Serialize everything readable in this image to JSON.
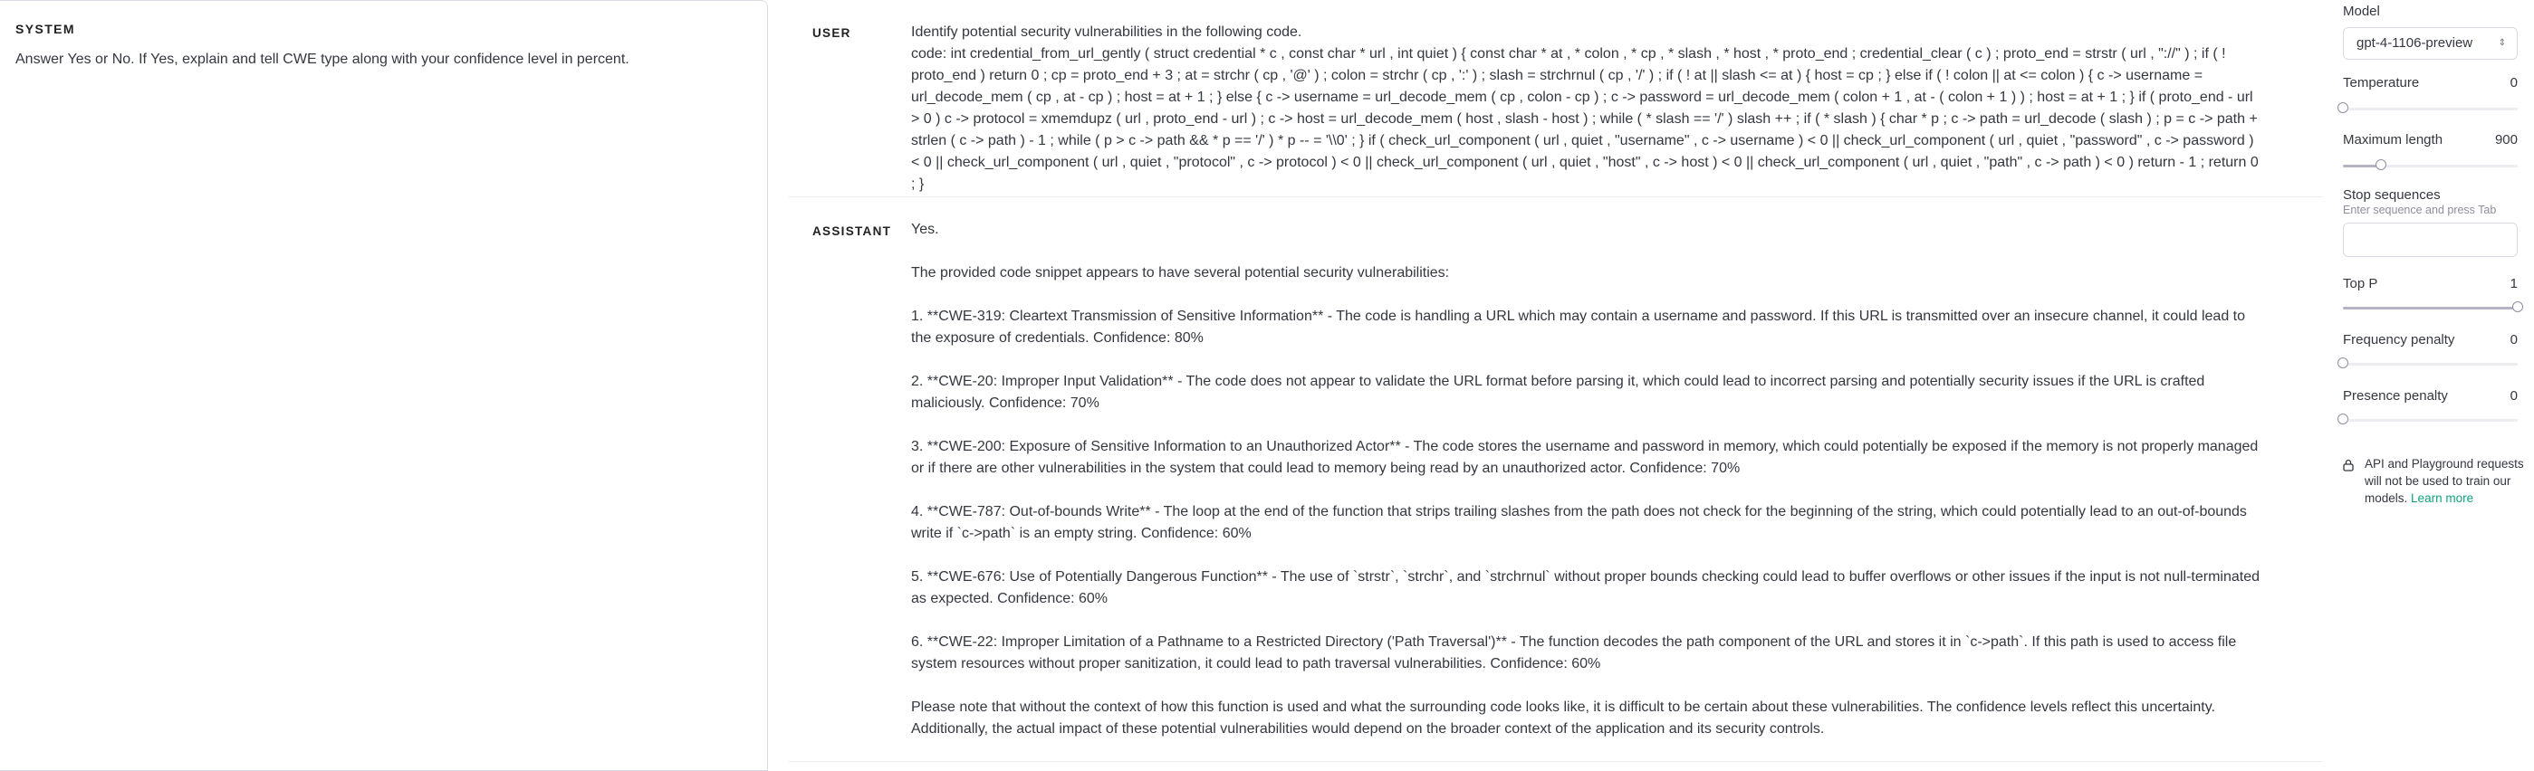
{
  "system": {
    "label": "SYSTEM",
    "text": "Answer Yes or No. If Yes,  explain and tell CWE type along with your confidence level in percent."
  },
  "user": {
    "label": "USER",
    "intro": "Identify potential security vulnerabilities in the following code.",
    "code": "code: int credential_from_url_gently ( struct credential * c , const char * url , int quiet ) { const char * at , * colon , * cp , * slash , * host , * proto_end ; credential_clear ( c ) ; proto_end = strstr ( url , \"://\" ) ; if ( ! proto_end ) return 0 ; cp = proto_end + 3 ; at = strchr ( cp , '@' ) ; colon = strchr ( cp , ':' ) ; slash = strchrnul ( cp , '/' ) ; if ( ! at || slash <= at ) { host = cp ; } else if ( ! colon || at <= colon ) { c -> username = url_decode_mem ( cp , at - cp ) ; host = at + 1 ; } else { c -> username = url_decode_mem ( cp , colon - cp ) ; c -> password = url_decode_mem ( colon + 1 , at - ( colon + 1 ) ) ; host = at + 1 ; } if ( proto_end - url > 0 ) c -> protocol = xmemdupz ( url , proto_end - url ) ; c -> host = url_decode_mem ( host , slash - host ) ; while ( * slash == '/' ) slash ++ ; if ( * slash ) { char * p ; c -> path = url_decode ( slash ) ; p = c -> path + strlen ( c -> path ) - 1 ; while ( p > c -> path && * p == '/' ) * p -- = '\\\\0' ; } if ( check_url_component ( url , quiet , \"username\" , c -> username ) < 0 || check_url_component ( url , quiet , \"password\" , c -> password ) < 0 || check_url_component ( url , quiet , \"protocol\" , c -> protocol ) < 0 || check_url_component ( url , quiet , \"host\" , c -> host ) < 0 || check_url_component ( url , quiet , \"path\" , c -> path ) < 0 ) return - 1 ; return 0 ; }"
  },
  "assistant": {
    "label": "ASSISTANT",
    "paragraphs": [
      "Yes.",
      "The provided code snippet appears to have several potential security vulnerabilities:",
      "1. **CWE-319: Cleartext Transmission of Sensitive Information** - The code is handling a URL which may contain a username and password. If this URL is transmitted over an insecure channel, it could lead to the exposure of credentials. Confidence: 80%",
      "2. **CWE-20: Improper Input Validation** - The code does not appear to validate the URL format before parsing it, which could lead to incorrect parsing and potentially security issues if the URL is crafted maliciously. Confidence: 70%",
      "3. **CWE-200: Exposure of Sensitive Information to an Unauthorized Actor** - The code stores the username and password in memory, which could potentially be exposed if the memory is not properly managed or if there are other vulnerabilities in the system that could lead to memory being read by an unauthorized actor. Confidence: 70%",
      "4. **CWE-787: Out-of-bounds Write** - The loop at the end of the function that strips trailing slashes from the path does not check for the beginning of the string, which could potentially lead to an out-of-bounds write if `c->path` is an empty string. Confidence: 60%",
      "5. **CWE-676: Use of Potentially Dangerous Function** - The use of `strstr`, `strchr`, and `strchrnul` without proper bounds checking could lead to buffer overflows or other issues if the input is not null-terminated as expected. Confidence: 60%",
      "6. **CWE-22: Improper Limitation of a Pathname to a Restricted Directory ('Path Traversal')** - The function decodes the path component of the URL and stores it in `c->path`. If this path is used to access file system resources without proper sanitization, it could lead to path traversal vulnerabilities. Confidence: 60%",
      "Please note that without the context of how this function is used and what the surrounding code looks like, it is difficult to be certain about these vulnerabilities. The confidence levels reflect this uncertainty. Additionally, the actual impact of these potential vulnerabilities would depend on the broader context of the application and its security controls."
    ]
  },
  "settings": {
    "model_label": "Model",
    "model_value": "gpt-4-1106-preview",
    "temperature_label": "Temperature",
    "temperature_value": "0",
    "temperature_fraction": 0,
    "max_length_label": "Maximum length",
    "max_length_value": "900",
    "max_length_fraction": 0.22,
    "stop_label": "Stop sequences",
    "stop_hint": "Enter sequence and press Tab",
    "top_p_label": "Top P",
    "top_p_value": "1",
    "top_p_fraction": 1,
    "frequency_label": "Frequency penalty",
    "frequency_value": "0",
    "frequency_fraction": 0,
    "presence_label": "Presence penalty",
    "presence_value": "0",
    "presence_fraction": 0,
    "privacy_text": "API and Playground requests will not be used to train our models.",
    "learn_more": "Learn more"
  },
  "colors": {
    "accent": "#10a37f",
    "border": "#d9d9e3",
    "text": "#353740"
  },
  "icons": {
    "model_select": "chevron-updown-icon",
    "privacy": "lock-icon"
  }
}
